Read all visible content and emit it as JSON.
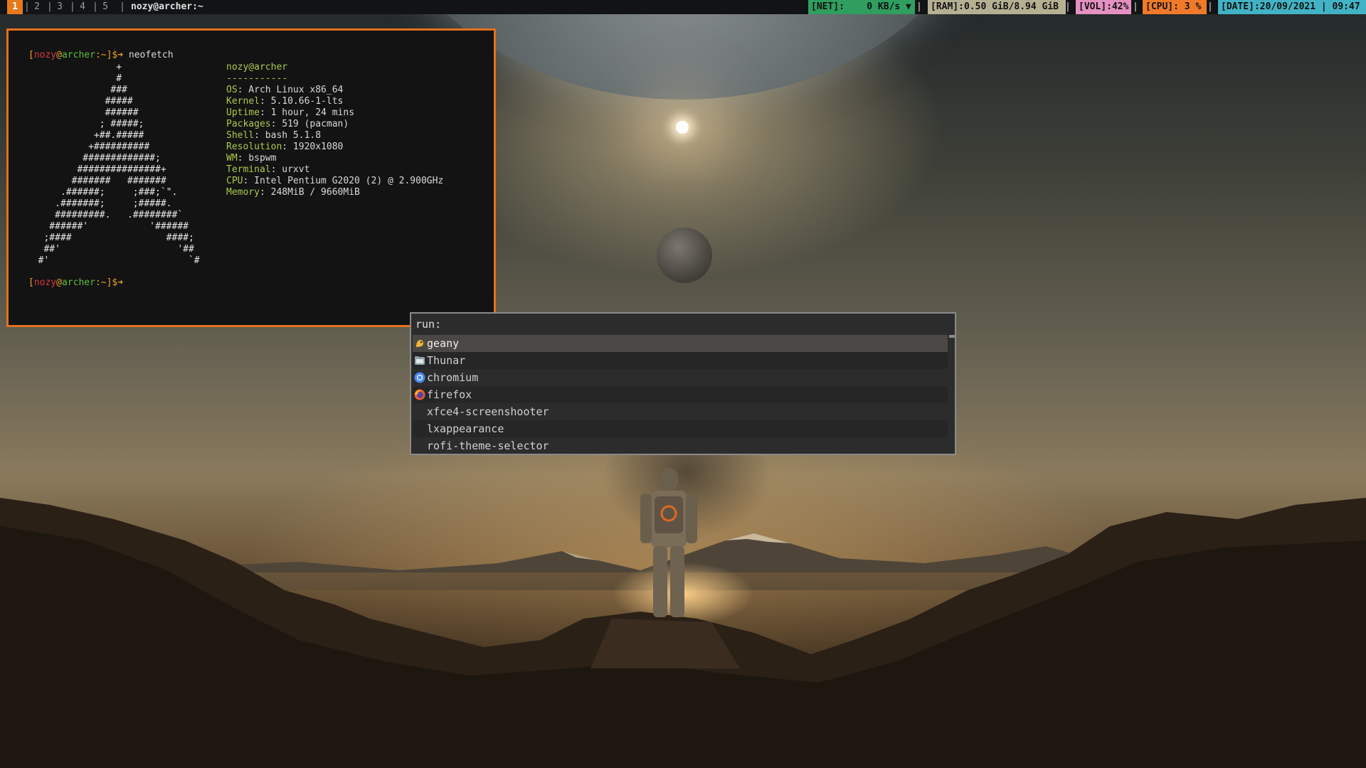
{
  "topbar": {
    "workspaces": [
      "1",
      "2",
      "3",
      "4",
      "5"
    ],
    "active_workspace": "1",
    "window_title": "nozy@archer:~",
    "separator": "|",
    "modules": {
      "net": "[NET]:    0 KB/s ▼",
      "ram": "[RAM]:0.50 GiB/8.94 GiB",
      "vol": "[VOL]:42%",
      "cpu": "[CPU]: 3 %",
      "date": "[DATE]:20/09/2021 | 09:47"
    },
    "colors": {
      "net": "#2f9e5f",
      "ram": "#b6b093",
      "vol": "#e590c2",
      "cpu": "#f07a2a",
      "date": "#41b3c4",
      "active_ws": "#e6791b"
    }
  },
  "terminal": {
    "prompt": {
      "open": "[",
      "user": "nozy",
      "at": "@",
      "host": "archer",
      "sep": ":",
      "dir": "~",
      "close": "]$➜"
    },
    "command": " neofetch",
    "logo": "                +\n                #\n               ###\n              #####\n              ######\n             ; #####;\n            +##.#####\n           +##########\n          #############;\n         ###############+\n        #######   #######\n      .######;     ;###;`\".\n     .#######;     ;#####.\n     #########.   .########`\n    ######'           '######\n   ;####                 ####;\n   ##'                     '##\n  #'                         `#",
    "info_header": "nozy@archer",
    "info_rule": "-----------",
    "info": [
      {
        "key": "OS",
        "value": ": Arch Linux x86_64"
      },
      {
        "key": "Kernel",
        "value": ": 5.10.66-1-lts"
      },
      {
        "key": "Uptime",
        "value": ": 1 hour, 24 mins"
      },
      {
        "key": "Packages",
        "value": ": 519 (pacman)"
      },
      {
        "key": "Shell",
        "value": ": bash 5.1.8"
      },
      {
        "key": "Resolution",
        "value": ": 1920x1080"
      },
      {
        "key": "WM",
        "value": ": bspwm"
      },
      {
        "key": "Terminal",
        "value": ": urxvt"
      },
      {
        "key": "CPU",
        "value": ": Intel Pentium G2020 (2) @ 2.900GHz"
      },
      {
        "key": "Memory",
        "value": ": 248MiB / 9660MiB"
      }
    ],
    "border_color": "#e3711f"
  },
  "rofi": {
    "prompt": "run:",
    "input_value": "",
    "items": [
      {
        "label": "geany",
        "icon": "geany-icon"
      },
      {
        "label": "Thunar",
        "icon": "thunar-icon"
      },
      {
        "label": "chromium",
        "icon": "chromium-icon"
      },
      {
        "label": "firefox",
        "icon": "firefox-icon"
      },
      {
        "label": "xfce4-screenshooter",
        "icon": ""
      },
      {
        "label": "lxappearance",
        "icon": ""
      },
      {
        "label": "rofi-theme-selector",
        "icon": ""
      }
    ],
    "selected_index": 0
  }
}
